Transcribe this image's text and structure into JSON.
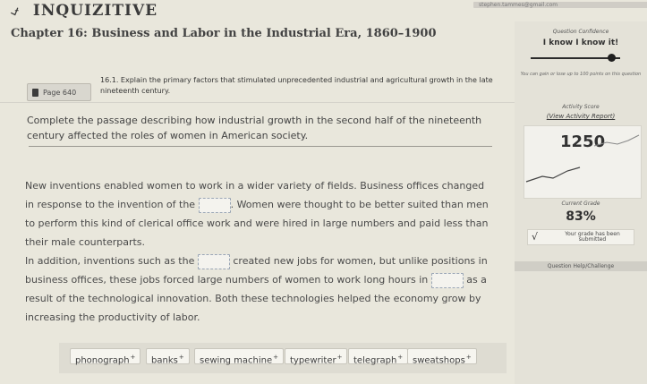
{
  "app": {
    "title": "inQuizitive",
    "user": "stephen.tammes@gmail.com"
  },
  "chapter": {
    "title": "Chapter 16: Business and Labor in the Industrial Era, 1860–1900"
  },
  "question": {
    "page_label": "Page 640",
    "number": "16.1.",
    "text": "Explain the primary factors that stimulated unprecedented industrial and agricultural growth in the late nineteenth century."
  },
  "instruction": "Complete the passage describing how industrial growth in the second half of the nineteenth century affected the roles of women in American society.",
  "passage": {
    "s1": "New inventions enabled women to work in a wider variety of fields. Business offices changed in response to the invention of the",
    "s2": ". Women were thought to be better suited than men to perform this kind of clerical office work and were hired in large numbers and paid less than their male counterparts.",
    "s3": "In addition, inventions such as the",
    "s4": "created new jobs for women, but unlike positions in business offices, these jobs forced large numbers of women to work long hours in",
    "s5": "as a result of the technological innovation. Both these technologies helped the economy grow by increasing the productivity of labor."
  },
  "word_bank": [
    {
      "label": "phonograph"
    },
    {
      "label": "banks"
    },
    {
      "label": "sewing machine"
    },
    {
      "label": "typewriter"
    },
    {
      "label": "telegraph"
    },
    {
      "label": "sweatshops"
    }
  ],
  "chip_marker": "+",
  "panel": {
    "confidence_label": "Question Confidence",
    "confidence_value": "I know I know it!",
    "confidence_note": "You can gain or lose up to 100 points on this question",
    "confidence_level": 0.9,
    "score_label": "Activity Score",
    "score_link": "(View Activity Report)",
    "score_value": "1250",
    "grade_label": "Current Grade",
    "grade_value": "83%",
    "submitted_check": "√",
    "submitted_text": "Your grade has been submitted",
    "help_label": "Question Help/Challenge"
  }
}
